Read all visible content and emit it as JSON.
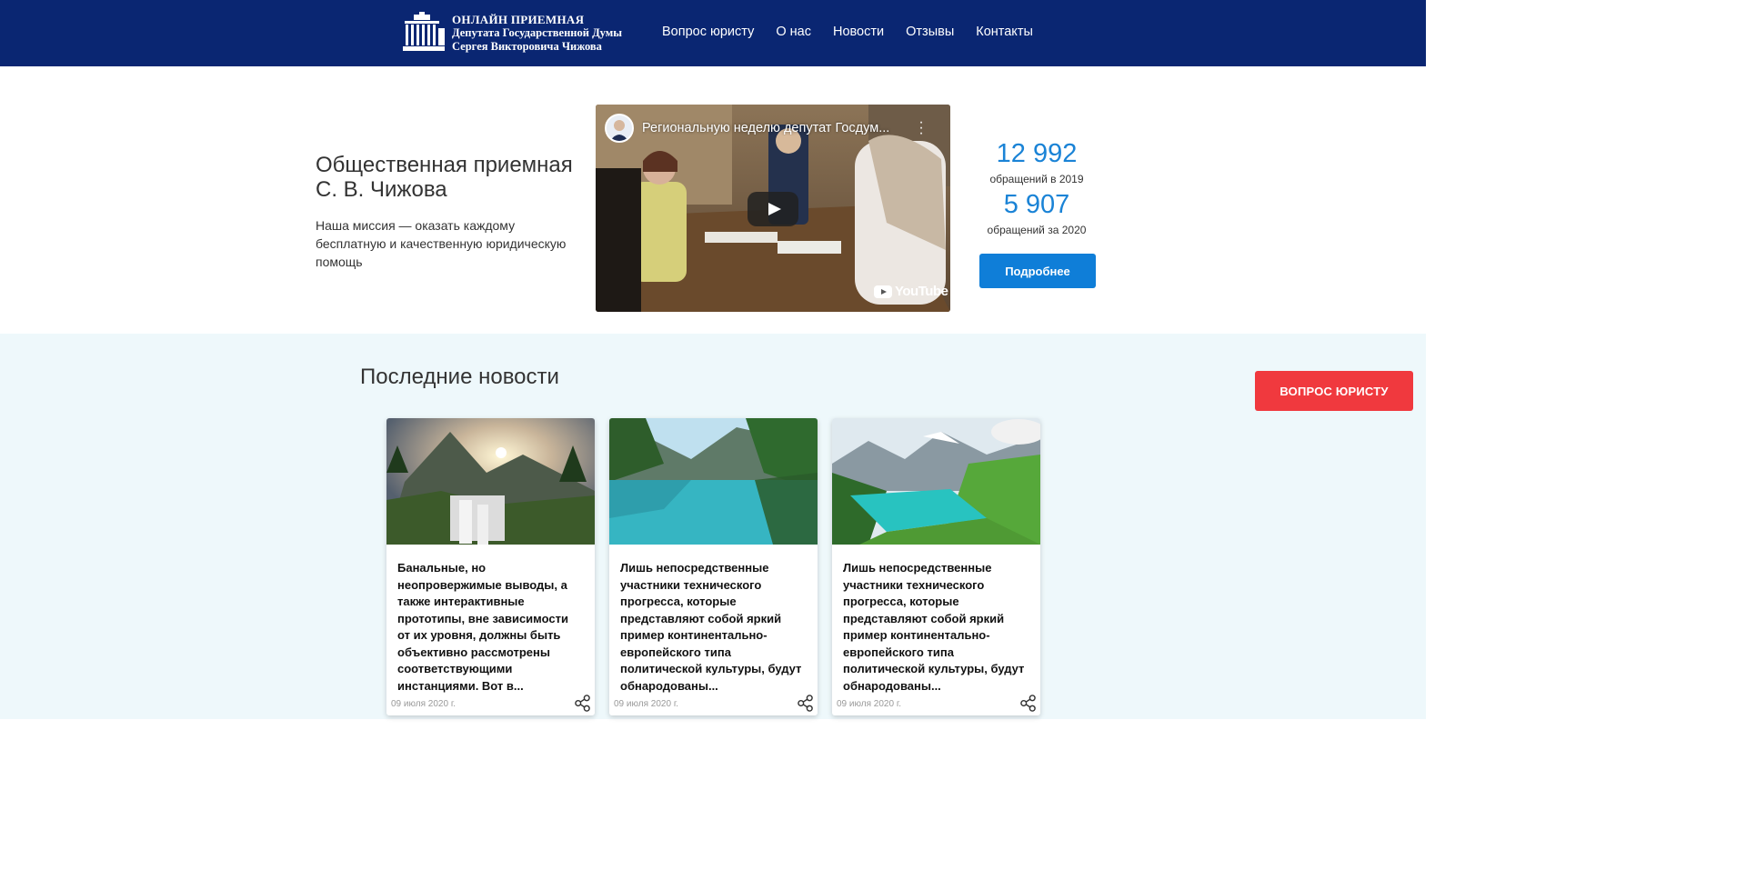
{
  "header": {
    "logo_line1": "ОНЛАЙН ПРИЕМНАЯ",
    "logo_line2": "Депутата Государственной Думы",
    "logo_line3": "Сергея Викторовича Чижова",
    "nav": [
      "Вопрос юристу",
      "О нас",
      "Новости",
      "Отзывы",
      "Контакты"
    ]
  },
  "hero": {
    "title_line1": "Общественная приемная",
    "title_line2": "С. В. Чижова",
    "description": "Наша миссия — оказать каждому бесплатную и качественную юридическую помощь"
  },
  "video": {
    "title": "Региональную неделю депутат Госдум...",
    "brand": "YouTube"
  },
  "stats": [
    {
      "value": "12 992",
      "label": "обращений в 2019"
    },
    {
      "value": "5 907",
      "label": "обращений за 2020"
    }
  ],
  "more_button": "Подробнее",
  "news": {
    "heading": "Последние новости",
    "ask_button": "ВОПРОС ЮРИСТУ",
    "cards": [
      {
        "text": "Банальные, но неопровержимые выводы, а также интерактивные прототипы, вне зависимости от их уровня, должны быть объективно рассмотрены соответствующими инстанциями. Вот в...",
        "date": "09 июля 2020 г."
      },
      {
        "text": "Лишь непосредственные участники технического прогресса, которые представляют собой яркий пример континентально-европейского типа политической культуры, будут обнародованы...",
        "date": "09 июля 2020 г."
      },
      {
        "text": "Лишь непосредственные участники технического прогресса, которые представляют собой яркий пример континентально-европейского типа политической культуры, будут обнародованы...",
        "date": "09 июля 2020 г."
      }
    ]
  },
  "colors": {
    "header_bg": "#0a2672",
    "accent_blue": "#0f7ed8",
    "stat_blue": "#1a83d6",
    "ask_red": "#f0393e",
    "news_bg": "#eef8fb"
  }
}
